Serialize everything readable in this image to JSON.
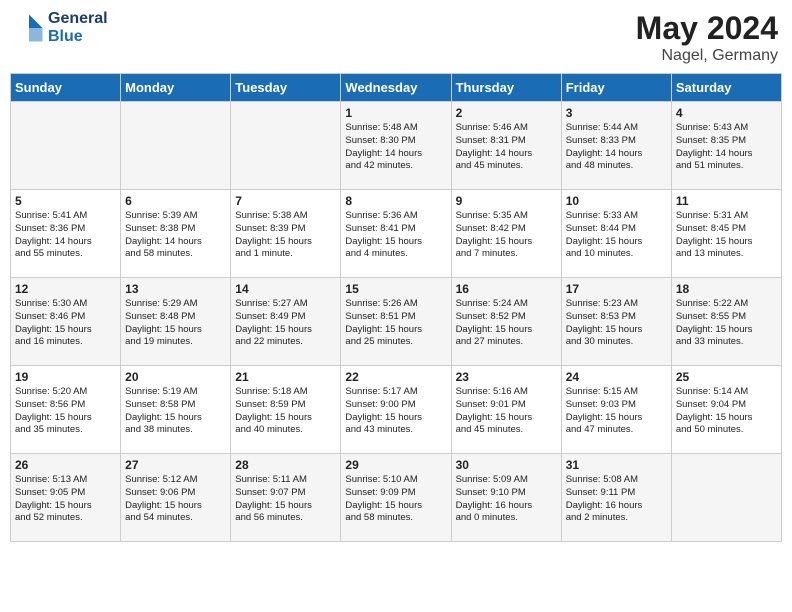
{
  "header": {
    "logo_line1": "General",
    "logo_line2": "Blue",
    "month_year": "May 2024",
    "location": "Nagel, Germany"
  },
  "days_of_week": [
    "Sunday",
    "Monday",
    "Tuesday",
    "Wednesday",
    "Thursday",
    "Friday",
    "Saturday"
  ],
  "weeks": [
    [
      {
        "day": "",
        "content": ""
      },
      {
        "day": "",
        "content": ""
      },
      {
        "day": "",
        "content": ""
      },
      {
        "day": "1",
        "content": "Sunrise: 5:48 AM\nSunset: 8:30 PM\nDaylight: 14 hours\nand 42 minutes."
      },
      {
        "day": "2",
        "content": "Sunrise: 5:46 AM\nSunset: 8:31 PM\nDaylight: 14 hours\nand 45 minutes."
      },
      {
        "day": "3",
        "content": "Sunrise: 5:44 AM\nSunset: 8:33 PM\nDaylight: 14 hours\nand 48 minutes."
      },
      {
        "day": "4",
        "content": "Sunrise: 5:43 AM\nSunset: 8:35 PM\nDaylight: 14 hours\nand 51 minutes."
      }
    ],
    [
      {
        "day": "5",
        "content": "Sunrise: 5:41 AM\nSunset: 8:36 PM\nDaylight: 14 hours\nand 55 minutes."
      },
      {
        "day": "6",
        "content": "Sunrise: 5:39 AM\nSunset: 8:38 PM\nDaylight: 14 hours\nand 58 minutes."
      },
      {
        "day": "7",
        "content": "Sunrise: 5:38 AM\nSunset: 8:39 PM\nDaylight: 15 hours\nand 1 minute."
      },
      {
        "day": "8",
        "content": "Sunrise: 5:36 AM\nSunset: 8:41 PM\nDaylight: 15 hours\nand 4 minutes."
      },
      {
        "day": "9",
        "content": "Sunrise: 5:35 AM\nSunset: 8:42 PM\nDaylight: 15 hours\nand 7 minutes."
      },
      {
        "day": "10",
        "content": "Sunrise: 5:33 AM\nSunset: 8:44 PM\nDaylight: 15 hours\nand 10 minutes."
      },
      {
        "day": "11",
        "content": "Sunrise: 5:31 AM\nSunset: 8:45 PM\nDaylight: 15 hours\nand 13 minutes."
      }
    ],
    [
      {
        "day": "12",
        "content": "Sunrise: 5:30 AM\nSunset: 8:46 PM\nDaylight: 15 hours\nand 16 minutes."
      },
      {
        "day": "13",
        "content": "Sunrise: 5:29 AM\nSunset: 8:48 PM\nDaylight: 15 hours\nand 19 minutes."
      },
      {
        "day": "14",
        "content": "Sunrise: 5:27 AM\nSunset: 8:49 PM\nDaylight: 15 hours\nand 22 minutes."
      },
      {
        "day": "15",
        "content": "Sunrise: 5:26 AM\nSunset: 8:51 PM\nDaylight: 15 hours\nand 25 minutes."
      },
      {
        "day": "16",
        "content": "Sunrise: 5:24 AM\nSunset: 8:52 PM\nDaylight: 15 hours\nand 27 minutes."
      },
      {
        "day": "17",
        "content": "Sunrise: 5:23 AM\nSunset: 8:53 PM\nDaylight: 15 hours\nand 30 minutes."
      },
      {
        "day": "18",
        "content": "Sunrise: 5:22 AM\nSunset: 8:55 PM\nDaylight: 15 hours\nand 33 minutes."
      }
    ],
    [
      {
        "day": "19",
        "content": "Sunrise: 5:20 AM\nSunset: 8:56 PM\nDaylight: 15 hours\nand 35 minutes."
      },
      {
        "day": "20",
        "content": "Sunrise: 5:19 AM\nSunset: 8:58 PM\nDaylight: 15 hours\nand 38 minutes."
      },
      {
        "day": "21",
        "content": "Sunrise: 5:18 AM\nSunset: 8:59 PM\nDaylight: 15 hours\nand 40 minutes."
      },
      {
        "day": "22",
        "content": "Sunrise: 5:17 AM\nSunset: 9:00 PM\nDaylight: 15 hours\nand 43 minutes."
      },
      {
        "day": "23",
        "content": "Sunrise: 5:16 AM\nSunset: 9:01 PM\nDaylight: 15 hours\nand 45 minutes."
      },
      {
        "day": "24",
        "content": "Sunrise: 5:15 AM\nSunset: 9:03 PM\nDaylight: 15 hours\nand 47 minutes."
      },
      {
        "day": "25",
        "content": "Sunrise: 5:14 AM\nSunset: 9:04 PM\nDaylight: 15 hours\nand 50 minutes."
      }
    ],
    [
      {
        "day": "26",
        "content": "Sunrise: 5:13 AM\nSunset: 9:05 PM\nDaylight: 15 hours\nand 52 minutes."
      },
      {
        "day": "27",
        "content": "Sunrise: 5:12 AM\nSunset: 9:06 PM\nDaylight: 15 hours\nand 54 minutes."
      },
      {
        "day": "28",
        "content": "Sunrise: 5:11 AM\nSunset: 9:07 PM\nDaylight: 15 hours\nand 56 minutes."
      },
      {
        "day": "29",
        "content": "Sunrise: 5:10 AM\nSunset: 9:09 PM\nDaylight: 15 hours\nand 58 minutes."
      },
      {
        "day": "30",
        "content": "Sunrise: 5:09 AM\nSunset: 9:10 PM\nDaylight: 16 hours\nand 0 minutes."
      },
      {
        "day": "31",
        "content": "Sunrise: 5:08 AM\nSunset: 9:11 PM\nDaylight: 16 hours\nand 2 minutes."
      },
      {
        "day": "",
        "content": ""
      }
    ]
  ]
}
